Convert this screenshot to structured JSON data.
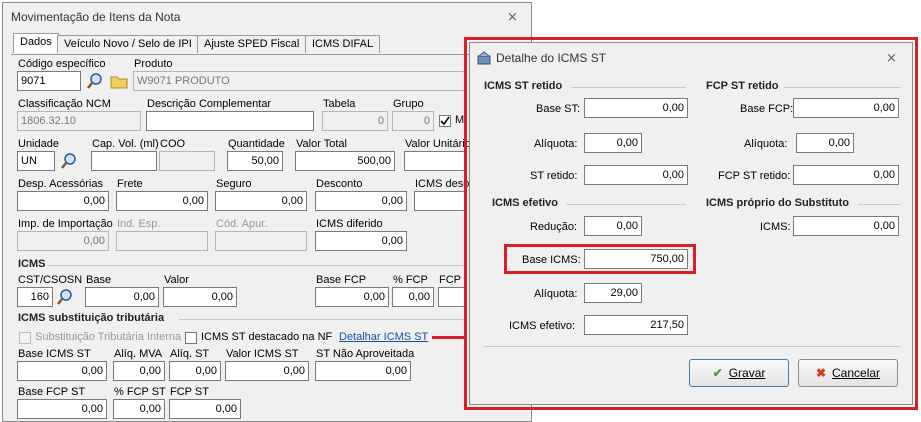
{
  "main": {
    "title": "Movimentação de Itens da Nota",
    "close": "⨯",
    "tabs": [
      "Dados",
      "Veículo Novo / Selo de IPI",
      "Ajuste SPED Fiscal",
      "ICMS DIFAL"
    ],
    "codigo_label": "Código específico",
    "codigo": "9071",
    "produto_label": "Produto",
    "produto": "W9071 PRODUTO",
    "ncm_label": "Classificação NCM",
    "ncm": "1806.32.10",
    "desc_label": "Descrição Complementar",
    "desc": "",
    "tabela_label": "Tabela",
    "tabela": "0",
    "grupo_label": "Grupo",
    "grupo": "0",
    "m_label": "M",
    "unidade_label": "Unidade",
    "unidade": "UN",
    "capvol_label": "Cap. Vol. (ml)",
    "capvol": "",
    "coo_label": "COO",
    "coo": "",
    "qtd_label": "Quantidade",
    "qtd": "50,00",
    "vtotal_label": "Valor Total",
    "vtotal": "500,00",
    "vunit_label": "Valor Unitário",
    "desp_label": "Desp. Acessórias",
    "desp": "0,00",
    "frete_label": "Frete",
    "frete": "0,00",
    "seguro_label": "Seguro",
    "seguro": "0,00",
    "desconto_label": "Desconto",
    "desconto": "0,00",
    "icmsdesc_label": "ICMS deso",
    "imp_label": "Imp. de Importação",
    "imp": "0,00",
    "indesp_label": "Ind. Esp.",
    "codapur_label": "Cód. Apur.",
    "icmsdif_label": "ICMS diferido",
    "icmsdif": "0,00",
    "icms_section": "ICMS",
    "cst_label": "CST/CSOSN",
    "cst": "160",
    "base_label": "Base",
    "base": "0,00",
    "valor_label": "Valor",
    "valor": "0,00",
    "basefcp_label": "Base FCP",
    "basefcp": "0,00",
    "pfcp_label": "% FCP",
    "pfcp": "0,00",
    "fcp_label": "FCP",
    "st_section": "ICMS substituição tributária",
    "subst_interna": "Substituição Tributária Interna",
    "icmsst_nf": "ICMS ST destacado na NF",
    "detalhar": "Detalhar ICMS ST",
    "baseicmsst_label": "Base ICMS ST",
    "baseicmsst": "0,00",
    "aliqmva_label": "Alíq. MVA",
    "aliqmva": "0,00",
    "aliqst_label": "Alíq. ST",
    "aliqst": "0,00",
    "valoricmsst_label": "Valor ICMS ST",
    "valoricmsst": "0,00",
    "stnaoaprov_label": "ST Não Aproveitada",
    "stnaoaprov": "0,00",
    "basefcpst_label": "Base FCP ST",
    "basefcpst": "0,00",
    "pfcpst_label": "% FCP ST",
    "pfcpst": "0,00",
    "fcpst_label": "FCP ST",
    "fcpst": "0,00"
  },
  "dialog": {
    "title": "Detalhe do ICMS ST",
    "close": "⨯",
    "icmsst_retido": "ICMS ST retido",
    "base_st_label": "Base ST:",
    "base_st": "0,00",
    "aliquota_label": "Alíquota:",
    "aliquota": "0,00",
    "st_retido_label": "ST retido:",
    "st_retido": "0,00",
    "fcpst_retido": "FCP ST retido",
    "base_fcp_label": "Base FCP:",
    "base_fcp": "0,00",
    "aliquota2_label": "Alíquota:",
    "aliquota2": "0,00",
    "fcp_st_retido_label": "FCP ST retido:",
    "fcp_st_retido": "0,00",
    "icms_efetivo": "ICMS efetivo",
    "reducao_label": "Redução:",
    "reducao": "0,00",
    "base_icms_label": "Base ICMS:",
    "base_icms": "750,00",
    "aliquota3_label": "Alíquota:",
    "aliquota3": "29,00",
    "icms_efetivo_label": "ICMS efetivo:",
    "icms_efetivo_val": "217,50",
    "icms_proprio": "ICMS próprio do Substituto",
    "icms_label": "ICMS:",
    "icms": "0,00",
    "gravar": "Gravar",
    "cancelar": "Cancelar"
  },
  "colors": {
    "highlight": "#d9202a",
    "link": "#1a4fa0"
  }
}
